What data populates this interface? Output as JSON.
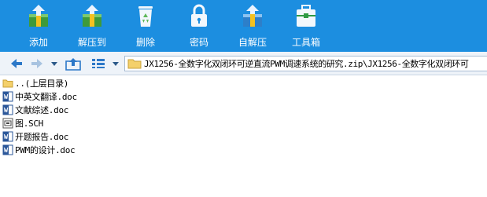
{
  "toolbar": {
    "buttons": [
      {
        "label": "添加",
        "icon": "add-archive-icon"
      },
      {
        "label": "解压到",
        "icon": "extract-to-icon"
      },
      {
        "label": "删除",
        "icon": "recycle-bin-icon"
      },
      {
        "label": "密码",
        "icon": "lock-icon"
      },
      {
        "label": "自解压",
        "icon": "self-extract-icon"
      },
      {
        "label": "工具箱",
        "icon": "toolbox-icon"
      }
    ],
    "colors": {
      "background": "#1c8ee0",
      "label": "#ffffff"
    }
  },
  "navbar": {
    "path": "JX1256-全数字化双闭环可逆直流PWM调速系统的研究.zip\\JX1256-全数字化双闭环可"
  },
  "files": [
    {
      "name": "..(上层目录)",
      "icon": "parent-folder-icon"
    },
    {
      "name": "中英文翻译.doc",
      "icon": "word-doc-icon"
    },
    {
      "name": "文献综述.doc",
      "icon": "word-doc-icon"
    },
    {
      "name": "图.SCH",
      "icon": "sch-file-icon"
    },
    {
      "name": "开题报告.doc",
      "icon": "word-doc-icon"
    },
    {
      "name": "PWM的设计.doc",
      "icon": "word-doc-icon"
    }
  ]
}
